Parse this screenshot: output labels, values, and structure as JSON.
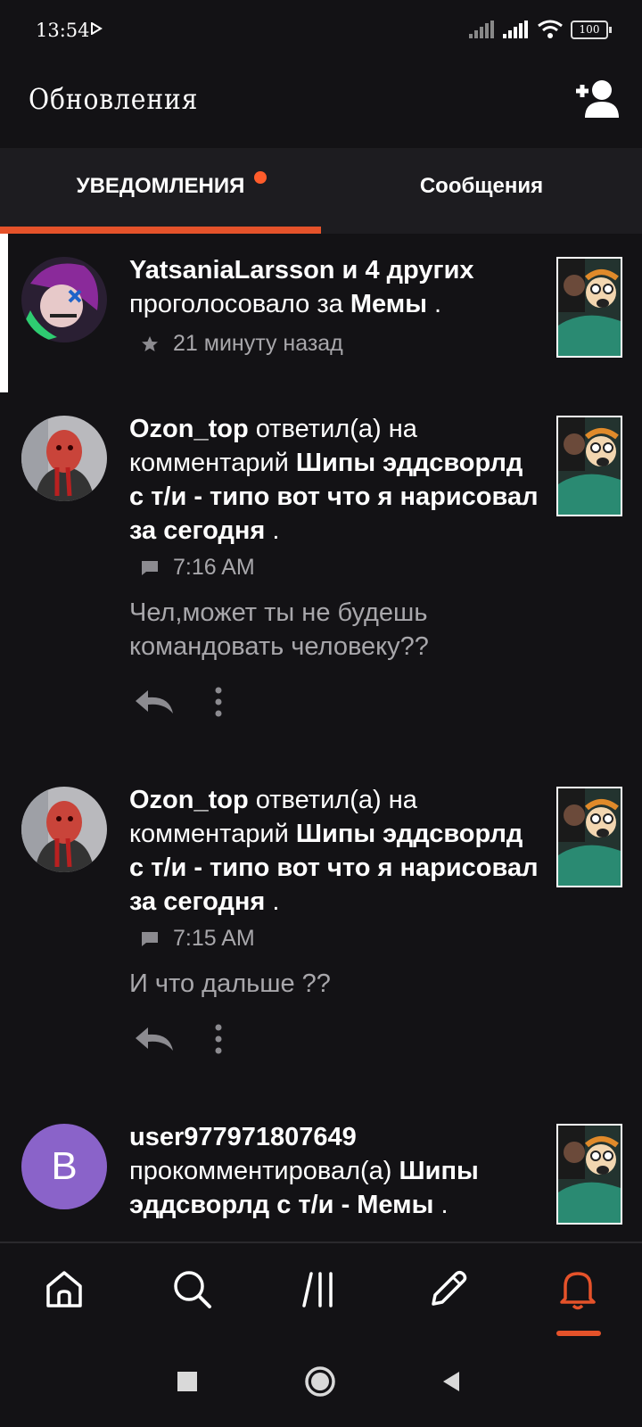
{
  "status_bar": {
    "time": "13:54",
    "battery": "100"
  },
  "header": {
    "title": "Обновления"
  },
  "tabs": [
    {
      "label": "УВЕДОМЛЕНИЯ",
      "active": true,
      "has_dot": true
    },
    {
      "label": "Сообщения",
      "active": false
    }
  ],
  "notifications": [
    {
      "user": "YatsaniaLarsson и 4 других",
      "action": "проголосовало за",
      "target": "Мемы",
      "suffix": ".",
      "meta_icon": "star-icon",
      "time": "21 минуту назад"
    },
    {
      "user": "Ozon_top",
      "action": "ответил(а) на комментарий",
      "target": "Шипы эддсворлд с т/и - типо вот что я нарисовал за сегодня",
      "suffix": ".",
      "meta_icon": "comment-icon",
      "time": "7:16 AM",
      "comment": "Чел,может ты не будешь командовать человеку??"
    },
    {
      "user": "Ozon_top",
      "action": "ответил(а) на комментарий",
      "target": "Шипы эддсворлд с т/и - типо вот что я нарисовал за сегодня",
      "suffix": ".",
      "meta_icon": "comment-icon",
      "time": "7:15 AM",
      "comment": "И что дальше ??"
    },
    {
      "user": "user977971807649",
      "avatar_letter": "B",
      "action": "прокомментировал(а)",
      "target": "Шипы эддсворлд с т/и - Мемы",
      "suffix": "."
    }
  ],
  "bottom_nav": [
    {
      "icon": "home-icon"
    },
    {
      "icon": "search-icon"
    },
    {
      "icon": "library-icon"
    },
    {
      "icon": "pencil-icon"
    },
    {
      "icon": "bell-icon",
      "active": true
    }
  ],
  "colors": {
    "accent": "#e5522a",
    "background": "#131215",
    "muted_text": "#a8a7ab",
    "avatar_purple": "#8a63c9"
  }
}
